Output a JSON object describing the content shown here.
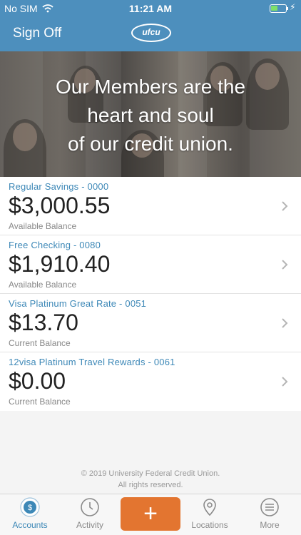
{
  "status_bar": {
    "carrier": "No SIM",
    "time": "11:21 AM",
    "battery_color": "#7ee06a"
  },
  "header": {
    "sign_off_label": "Sign Off",
    "logo_text": "ufcu",
    "background": "#4d8fbd"
  },
  "hero": {
    "headline_lines": [
      "Our Members are the",
      "heart and soul",
      "of our credit union."
    ]
  },
  "accounts": [
    {
      "name": "Regular Savings - 0000",
      "amount": "$3,000.55",
      "balance_label": "Available Balance"
    },
    {
      "name": "Free Checking - 0080",
      "amount": "$1,910.40",
      "balance_label": "Available Balance"
    },
    {
      "name": "Visa Platinum Great Rate - 0051",
      "amount": "$13.70",
      "balance_label": "Current Balance"
    },
    {
      "name": "12visa Platinum Travel Rewards - 0061",
      "amount": "$0.00",
      "balance_label": "Current Balance"
    }
  ],
  "footer": {
    "copyright": "© 2019 University Federal Credit Union.",
    "rights": "All rights reserved."
  },
  "tabbar": {
    "accent": "#3d88b7",
    "add_button_color": "#e37530",
    "tabs": [
      {
        "label": "Accounts",
        "icon": "dollar-circle-icon",
        "active": true
      },
      {
        "label": "Activity",
        "icon": "clock-icon",
        "active": false
      },
      {
        "label": "Locations",
        "icon": "map-pin-icon",
        "active": false
      },
      {
        "label": "More",
        "icon": "menu-icon",
        "active": false
      }
    ]
  }
}
